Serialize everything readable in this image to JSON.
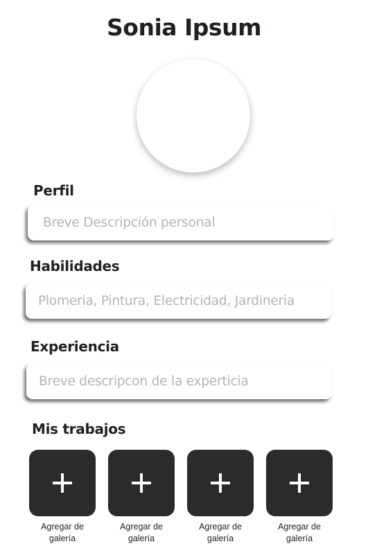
{
  "profile": {
    "name": "Sonia Ipsum"
  },
  "sections": {
    "perfil": {
      "label": "Perfil",
      "placeholder": "Breve Descripción personal"
    },
    "habilidades": {
      "label": "Habilidades",
      "placeholder": "Plomeria, Pintura, Electricidad, Jardineria"
    },
    "experiencia": {
      "label": "Experiencia",
      "placeholder": "Breve descripcon de la experticia"
    }
  },
  "gallery": {
    "label": "Mis trabajos",
    "tiles": [
      {
        "icon": "plus-icon",
        "caption_line1": "Agregar de",
        "caption_line2": "galería"
      },
      {
        "icon": "plus-icon",
        "caption_line1": "Agregar de",
        "caption_line2": "galería"
      },
      {
        "icon": "plus-icon",
        "caption_line1": "Agregar de",
        "caption_line2": "galería"
      },
      {
        "icon": "plus-icon",
        "caption_line1": "Agregar de",
        "caption_line2": "galería"
      }
    ]
  },
  "colors": {
    "text": "#231f20",
    "placeholder": "#b3b3b3",
    "tile": "#2b2b2b"
  }
}
